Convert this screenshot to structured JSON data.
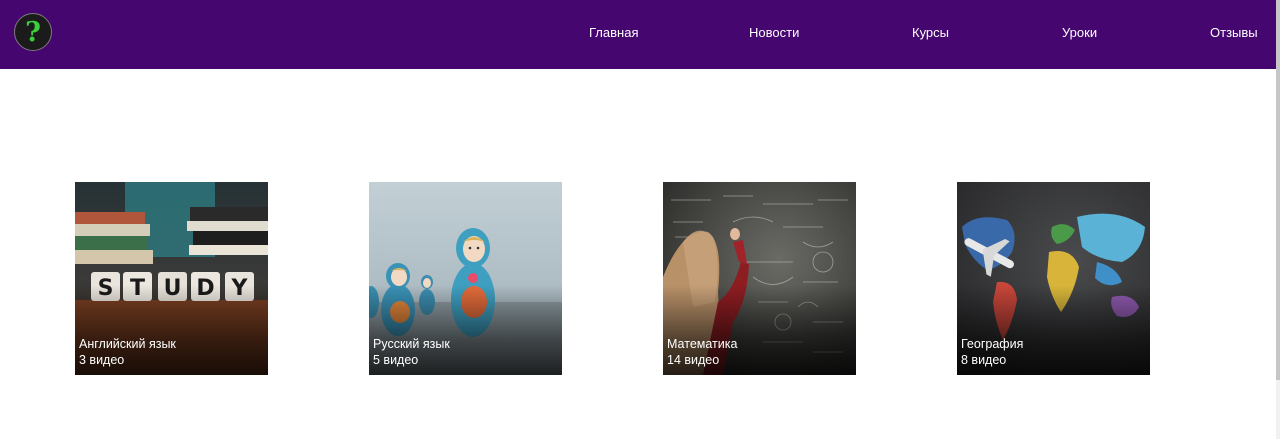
{
  "header": {
    "logo_icon": "question-mark-icon",
    "logo_glyph": "?",
    "nav": [
      {
        "label": "Главная"
      },
      {
        "label": "Новости"
      },
      {
        "label": "Курсы"
      },
      {
        "label": "Уроки"
      },
      {
        "label": "Отзывы"
      }
    ]
  },
  "courses": [
    {
      "title": "Английский язык",
      "count": "3 видео",
      "image": "study-dice-books-image",
      "art_text": "STUDY"
    },
    {
      "title": "Русский язык",
      "count": "5 видео",
      "image": "matryoshka-dolls-image"
    },
    {
      "title": "Математика",
      "count": "14 видео",
      "image": "chalkboard-math-image"
    },
    {
      "title": "География",
      "count": "8 видео",
      "image": "world-map-airplane-image"
    }
  ],
  "colors": {
    "navbar": "#45066f",
    "logo_glyph": "#3ccf3c",
    "text_on_dark": "#ffffff"
  }
}
